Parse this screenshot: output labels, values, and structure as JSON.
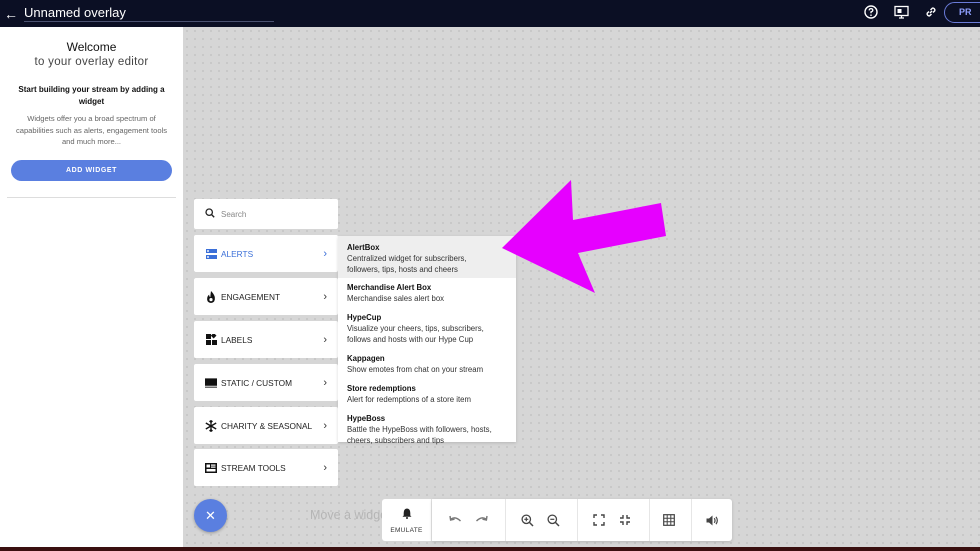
{
  "header": {
    "title": "Unnamed overlay",
    "preview_label": "PR",
    "icons": [
      "back-arrow-icon",
      "help-icon",
      "preview-screen-icon",
      "link-icon"
    ]
  },
  "left_panel": {
    "welcome_title": "Welcome",
    "welcome_subtitle": "to your overlay editor",
    "start_text": "Start building your stream by adding a widget",
    "description": "Widgets offer you a broad spectrum of capabilities such as alerts, engagement tools and much more...",
    "add_widget_label": "ADD WIDGET"
  },
  "widget_menu": {
    "search_placeholder": "Search",
    "categories": [
      {
        "label": "ALERTS",
        "icon": "alerts-icon",
        "active": true
      },
      {
        "label": "ENGAGEMENT",
        "icon": "flame-icon"
      },
      {
        "label": "LABELS",
        "icon": "labels-icon"
      },
      {
        "label": "STATIC / CUSTOM",
        "icon": "static-custom-icon"
      },
      {
        "label": "CHARITY & SEASONAL",
        "icon": "snowflake-icon"
      },
      {
        "label": "STREAM TOOLS",
        "icon": "stream-tools-icon"
      }
    ],
    "alerts_submenu": [
      {
        "title": "AlertBox",
        "desc_lines": [
          "Centralized widget for subscribers,",
          "followers, tips, hosts and cheers"
        ]
      },
      {
        "title": "Merchandise Alert Box",
        "desc_lines": [
          "Merchandise sales alert box"
        ]
      },
      {
        "title": "HypeCup",
        "desc_lines": [
          "Visualize your cheers, tips, subscribers,",
          "follows and hosts with our Hype Cup"
        ]
      },
      {
        "title": "Kappagen",
        "desc_lines": [
          "Show emotes from chat on your stream"
        ]
      },
      {
        "title": "Store redemptions",
        "desc_lines": [
          "Alert for redemptions of a store item"
        ]
      },
      {
        "title": "HypeBoss",
        "desc_lines": [
          "Battle the HypeBoss with followers, hosts,",
          "cheers, subscribers and tips"
        ]
      }
    ]
  },
  "canvas": {
    "hint_text": "Move a widget"
  },
  "toolbar": {
    "emulate_label": "EMULATE",
    "tools": [
      "undo-icon",
      "redo-icon",
      "zoom-in-icon",
      "zoom-out-icon",
      "fullscreen-icon",
      "exit-fullscreen-icon",
      "grid-icon",
      "volume-icon"
    ]
  },
  "colors": {
    "topbar": "#0b0f24",
    "accent": "#5a7fe0",
    "active_category": "#3b6fd8",
    "annotation_arrow": "#e600ff"
  }
}
